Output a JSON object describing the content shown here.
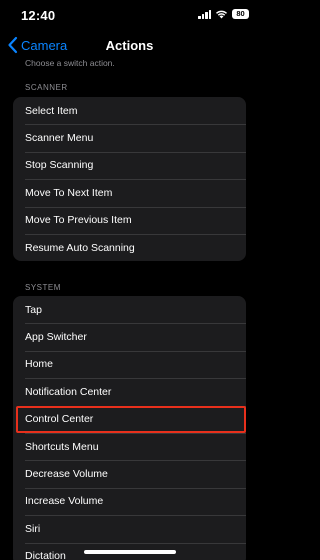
{
  "status_bar": {
    "time": "12:40",
    "battery": "80",
    "icons": [
      "signal-icon",
      "wifi-icon",
      "battery-icon"
    ]
  },
  "nav": {
    "back_label": "Camera",
    "title": "Actions"
  },
  "hint": "Choose a switch action.",
  "scanner": {
    "header": "SCANNER",
    "items": [
      "Select Item",
      "Scanner Menu",
      "Stop Scanning",
      "Move To Next Item",
      "Move To Previous Item",
      "Resume Auto Scanning"
    ]
  },
  "system": {
    "header": "SYSTEM",
    "items": [
      "Tap",
      "App Switcher",
      "Home",
      "Notification Center",
      "Control Center",
      "Shortcuts Menu",
      "Decrease Volume",
      "Increase Volume",
      "Siri",
      "Dictation"
    ],
    "highlighted_item": "Control Center"
  },
  "colors": {
    "accent": "#0a84ff",
    "highlight": "#e8301c",
    "background": "#000000",
    "cell": "#1c1c1e"
  }
}
